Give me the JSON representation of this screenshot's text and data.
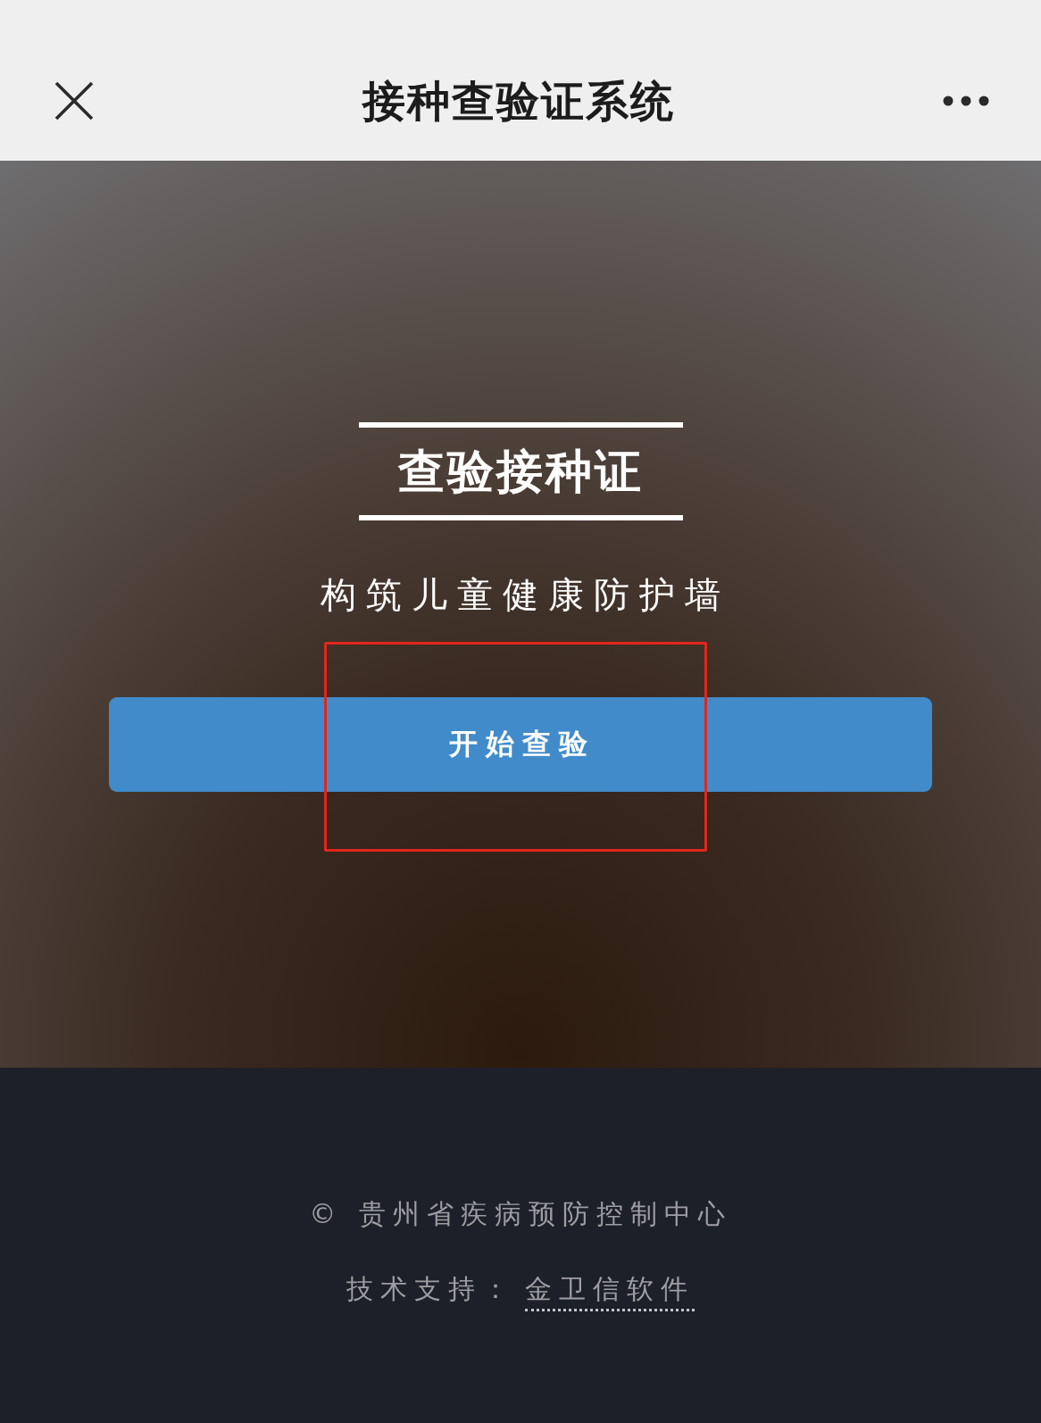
{
  "header": {
    "title": "接种查验证系统"
  },
  "hero": {
    "title": "查验接种证",
    "subtitle": "构筑儿童健康防护墙",
    "button": {
      "label": "开始查验"
    },
    "annotation": {
      "kind": "frame"
    }
  },
  "footer": {
    "copyright": "© 贵州省疾病预防控制中心",
    "support_label": "技术支持：",
    "support_link": "金卫信软件"
  }
}
